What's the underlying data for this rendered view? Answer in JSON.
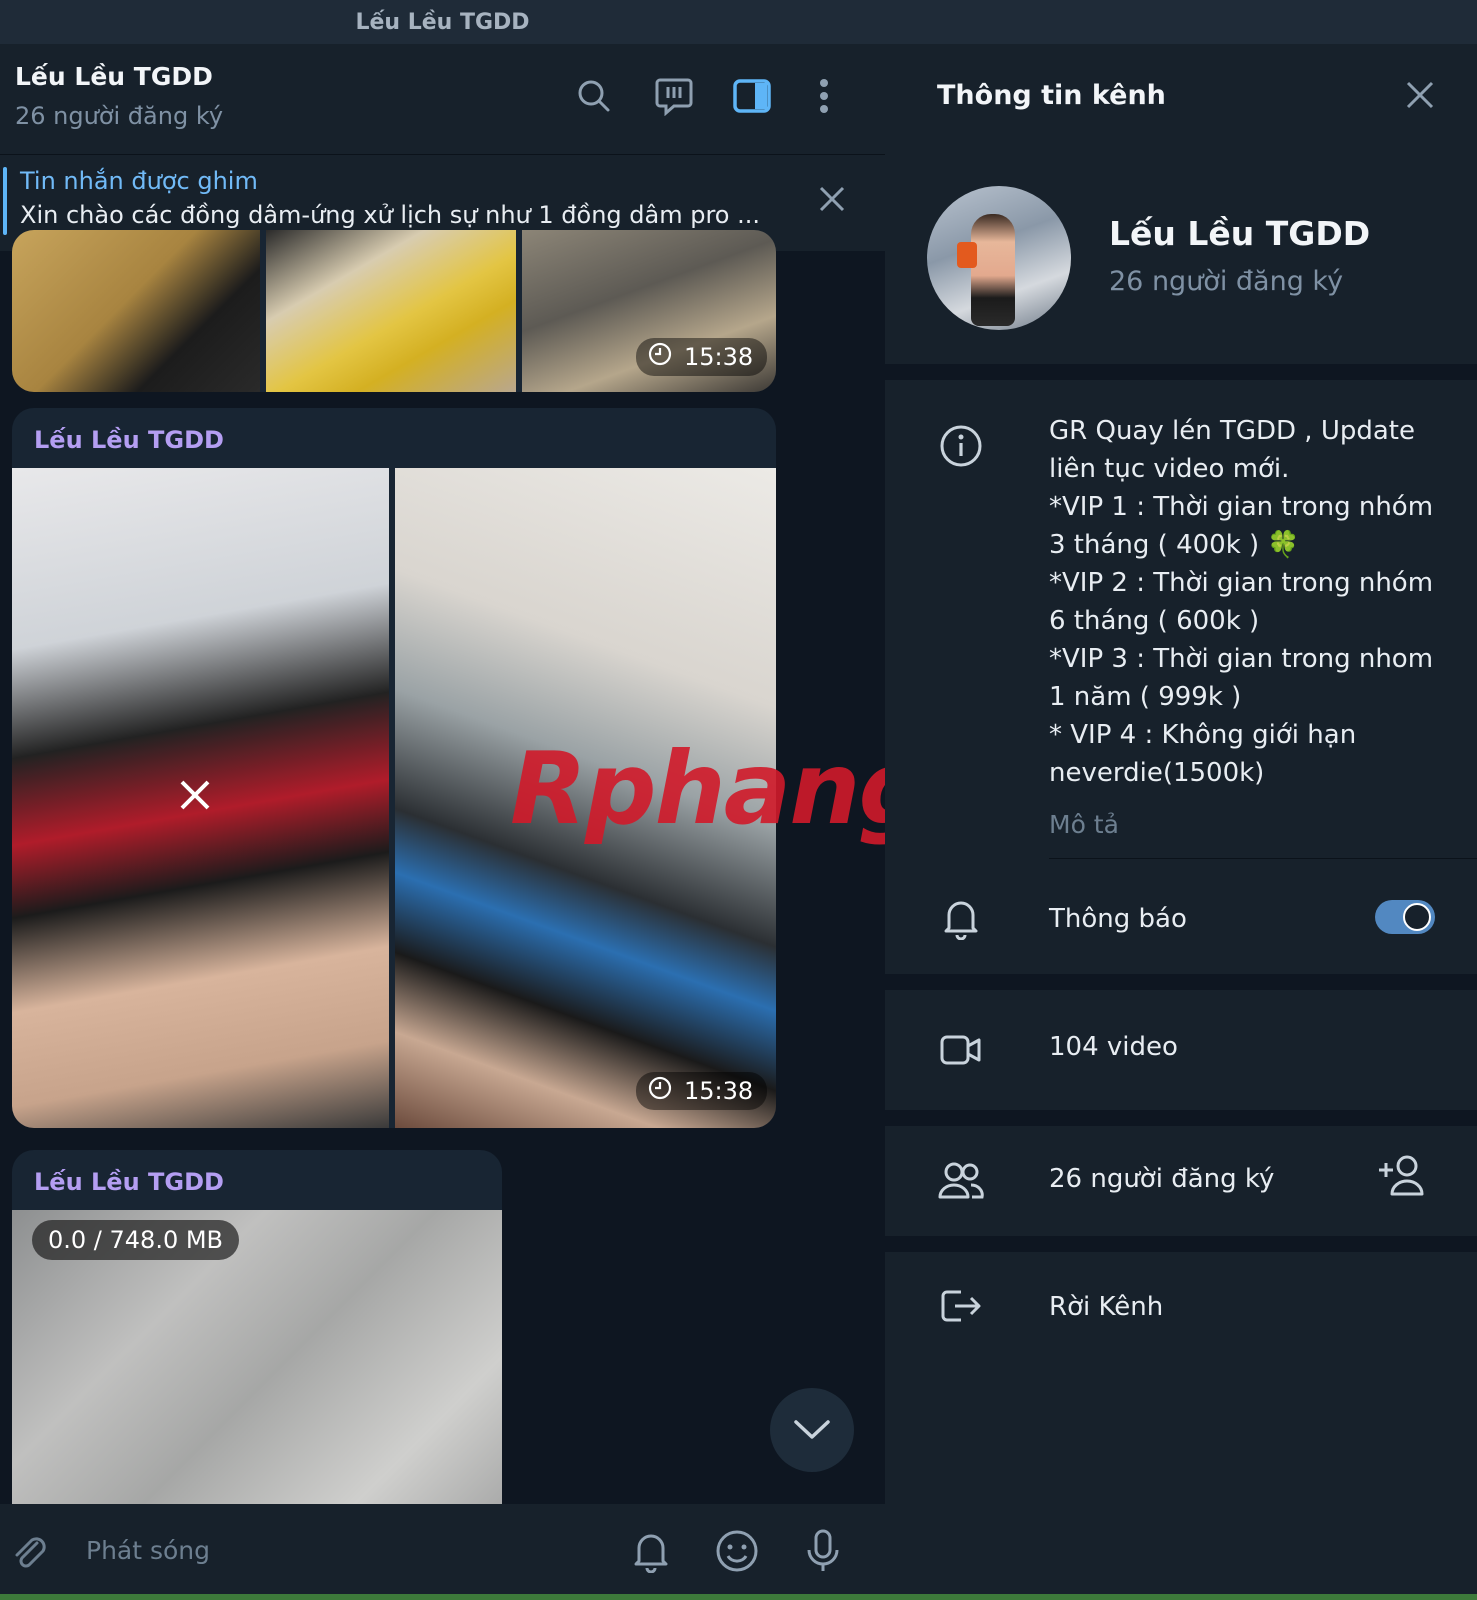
{
  "window": {
    "title": "Lếu Lều TGDD"
  },
  "chat": {
    "name": "Lếu Lều TGDD",
    "subscribers": "26 người đăng ký",
    "pinned": {
      "title": "Tin nhắn được ghim",
      "text": "Xin chào các đồng dâm-ứng xử lịch sự như 1 đồng dâm pro ..."
    },
    "messages": [
      {
        "duration": "15:38"
      },
      {
        "sender": "Lếu Lều TGDD",
        "duration": "15:38"
      },
      {
        "sender": "Lếu Lều TGDD",
        "download": "0.0 / 748.0 MB"
      }
    ],
    "overlay_text": "Rphang",
    "composer": {
      "placeholder": "Phát sóng"
    }
  },
  "panel": {
    "title": "Thông tin kênh",
    "channel_name": "Lếu Lều TGDD",
    "subscribers": "26 người đăng ký",
    "description_lines": [
      "GR Quay lén TGDD , Update",
      "liên tục video mới.",
      "*VIP 1 : Thời gian trong nhóm",
      "3 tháng ( 400k ) 🍀",
      "*VIP  2 : Thời gian trong nhóm",
      "6 tháng ( 600k  )",
      "*VIP  3 : Thời gian trong nhom",
      "1 năm ( 999k )",
      "* VIP 4  : Không giới hạn",
      "neverdie(1500k)"
    ],
    "description_label": "Mô tả",
    "notifications_label": "Thông báo",
    "notifications_on": true,
    "videos_label": "104 video",
    "members_label": "26 người đăng ký",
    "leave_label": "Rời Kênh"
  },
  "colors": {
    "accent": "#5eb5f7",
    "sender": "#b49ef2",
    "toggle": "#5288c1",
    "panel_bg": "#17212b",
    "chat_bg": "#0e1621"
  },
  "icons": [
    "search-icon",
    "topics-icon",
    "sidebar-toggle-icon",
    "more-icon",
    "close-icon",
    "clock-icon",
    "chevron-down-icon",
    "attach-icon",
    "bell-icon",
    "emoji-icon",
    "mic-icon",
    "info-icon",
    "video-icon",
    "members-icon",
    "add-member-icon",
    "leave-icon"
  ]
}
